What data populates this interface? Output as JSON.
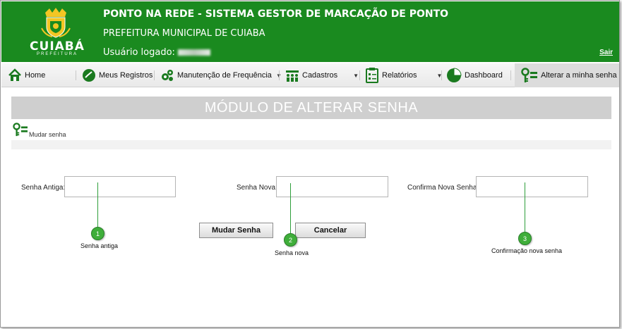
{
  "header": {
    "logo_text": "CUIABÁ",
    "logo_subtext": "PREFEITURA",
    "title": "PONTO NA REDE - SISTEMA GESTOR DE MARCAÇÃO DE PONTO",
    "subtitle": "PREFEITURA MUNICIPAL DE CUIABA",
    "user_label": "Usuário logado:",
    "logout": "Sair"
  },
  "menu": {
    "items": [
      {
        "label": "Home",
        "icon": "home-icon"
      },
      {
        "label": "Meus Registros",
        "icon": "check-circle-icon"
      },
      {
        "label": "Manutenção de Frequência",
        "icon": "gears-icon",
        "dropdown": true
      },
      {
        "label": "Cadastros",
        "icon": "people-icon",
        "dropdown": true
      },
      {
        "label": "Relatórios",
        "icon": "report-icon",
        "dropdown": true
      },
      {
        "label": "Dashboard",
        "icon": "pie-chart-icon"
      },
      {
        "label": "Alterar a minha senha",
        "icon": "key-icon",
        "active": true
      }
    ]
  },
  "page": {
    "title": "MÓDULO DE ALTERAR SENHA",
    "breadcrumb": "Mudar senha"
  },
  "form": {
    "old_password_label": "Senha Antiga:",
    "new_password_label": "Senha Nova:",
    "confirm_password_label": "Confirma Nova Senha:",
    "old_password_value": "",
    "new_password_value": "",
    "confirm_password_value": "",
    "submit_label": "Mudar Senha",
    "cancel_label": "Cancelar"
  },
  "callouts": [
    {
      "number": "1",
      "text": "Senha antiga"
    },
    {
      "number": "2",
      "text": "Senha nova"
    },
    {
      "number": "3",
      "text": "Confirmação nova senha"
    }
  ],
  "colors": {
    "header_green": "#1a8a1f",
    "callout_green": "#3fae3a",
    "title_bar_gray": "#cfcfcf"
  }
}
